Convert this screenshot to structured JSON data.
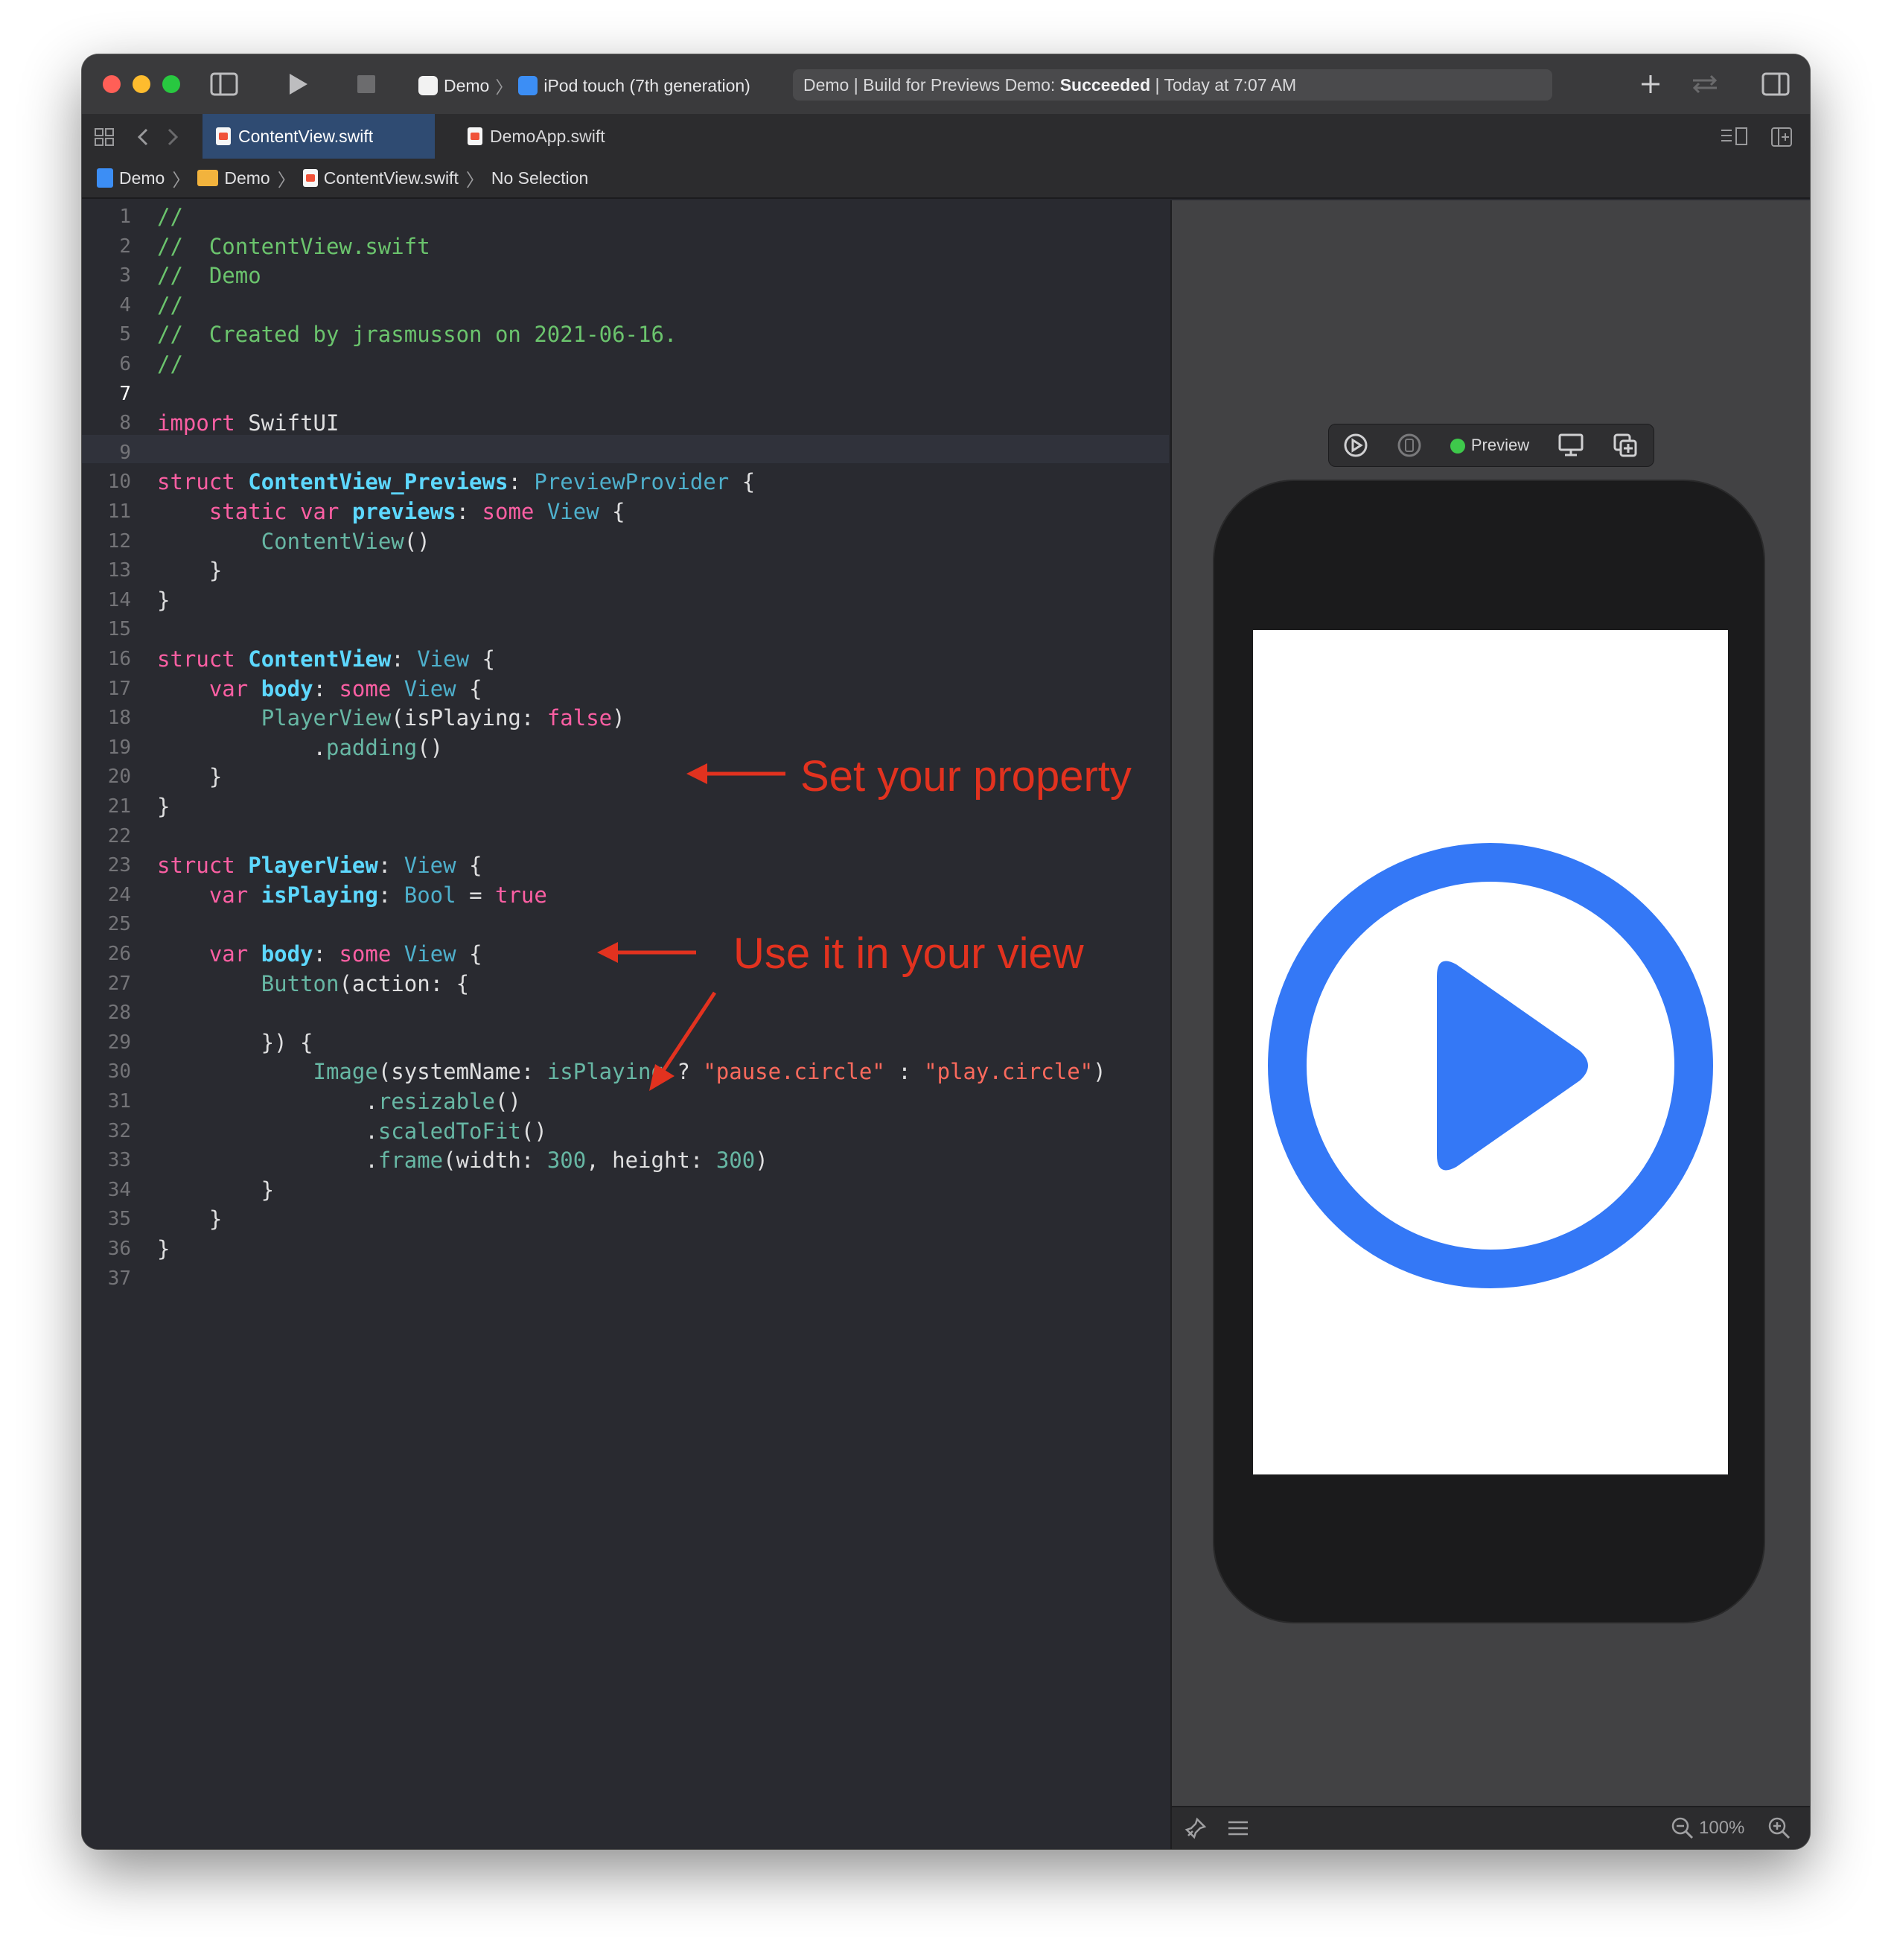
{
  "toolbar": {
    "scheme_app": "Demo",
    "scheme_device": "iPod touch (7th generation)",
    "activity_prefix": "Demo | Build for Previews Demo: ",
    "activity_status": "Succeeded",
    "activity_suffix": " | Today at 7:07 AM",
    "colors": {
      "close": "#ff5f57",
      "minimize": "#febc2e",
      "zoom": "#28c840"
    }
  },
  "tabs": [
    {
      "label": "ContentView.swift",
      "active": true
    },
    {
      "label": "DemoApp.swift",
      "active": false
    }
  ],
  "jumpbar": {
    "items": [
      "Demo",
      "Demo",
      "ContentView.swift",
      "No Selection"
    ]
  },
  "editor": {
    "current_line": 7,
    "lines": [
      [
        [
          "c-com",
          "//"
        ]
      ],
      [
        [
          "c-com",
          "//  ContentView.swift"
        ]
      ],
      [
        [
          "c-com",
          "//  Demo"
        ]
      ],
      [
        [
          "c-com",
          "//"
        ]
      ],
      [
        [
          "c-com",
          "//  Created by jrasmusson on 2021-06-16."
        ]
      ],
      [
        [
          "c-com",
          "//"
        ]
      ],
      [],
      [
        [
          "c-kw",
          "import"
        ],
        [
          "c-pl",
          " SwiftUI"
        ]
      ],
      [],
      [
        [
          "c-kw",
          "struct"
        ],
        [
          "c-pl",
          " "
        ],
        [
          "c-type",
          "ContentView_Previews"
        ],
        [
          "c-pl",
          ": "
        ],
        [
          "c-typ2",
          "PreviewProvider"
        ],
        [
          "c-pl",
          " {"
        ]
      ],
      [
        [
          "c-pl",
          "    "
        ],
        [
          "c-kw",
          "static var"
        ],
        [
          "c-pl",
          " "
        ],
        [
          "c-type",
          "previews"
        ],
        [
          "c-pl",
          ": "
        ],
        [
          "c-kw",
          "some"
        ],
        [
          "c-pl",
          " "
        ],
        [
          "c-typ2",
          "View"
        ],
        [
          "c-pl",
          " {"
        ]
      ],
      [
        [
          "c-pl",
          "        "
        ],
        [
          "c-call",
          "ContentView"
        ],
        [
          "c-pl",
          "()"
        ]
      ],
      [
        [
          "c-pl",
          "    }"
        ]
      ],
      [
        [
          "c-pl",
          "}"
        ]
      ],
      [],
      [
        [
          "c-kw",
          "struct"
        ],
        [
          "c-pl",
          " "
        ],
        [
          "c-type",
          "ContentView"
        ],
        [
          "c-pl",
          ": "
        ],
        [
          "c-typ2",
          "View"
        ],
        [
          "c-pl",
          " {"
        ]
      ],
      [
        [
          "c-pl",
          "    "
        ],
        [
          "c-kw",
          "var"
        ],
        [
          "c-pl",
          " "
        ],
        [
          "c-type",
          "body"
        ],
        [
          "c-pl",
          ": "
        ],
        [
          "c-kw",
          "some"
        ],
        [
          "c-pl",
          " "
        ],
        [
          "c-typ2",
          "View"
        ],
        [
          "c-pl",
          " {"
        ]
      ],
      [
        [
          "c-pl",
          "        "
        ],
        [
          "c-call",
          "PlayerView"
        ],
        [
          "c-pl",
          "(isPlaying: "
        ],
        [
          "c-kw",
          "false"
        ],
        [
          "c-pl",
          ")"
        ]
      ],
      [
        [
          "c-pl",
          "            ."
        ],
        [
          "c-call",
          "padding"
        ],
        [
          "c-pl",
          "()"
        ]
      ],
      [
        [
          "c-pl",
          "    }"
        ]
      ],
      [
        [
          "c-pl",
          "}"
        ]
      ],
      [],
      [
        [
          "c-kw",
          "struct"
        ],
        [
          "c-pl",
          " "
        ],
        [
          "c-type",
          "PlayerView"
        ],
        [
          "c-pl",
          ": "
        ],
        [
          "c-typ2",
          "View"
        ],
        [
          "c-pl",
          " {"
        ]
      ],
      [
        [
          "c-pl",
          "    "
        ],
        [
          "c-kw",
          "var"
        ],
        [
          "c-pl",
          " "
        ],
        [
          "c-type",
          "isPlaying"
        ],
        [
          "c-pl",
          ": "
        ],
        [
          "c-typ2",
          "Bool"
        ],
        [
          "c-pl",
          " = "
        ],
        [
          "c-kw",
          "true"
        ]
      ],
      [],
      [
        [
          "c-pl",
          "    "
        ],
        [
          "c-kw",
          "var"
        ],
        [
          "c-pl",
          " "
        ],
        [
          "c-type",
          "body"
        ],
        [
          "c-pl",
          ": "
        ],
        [
          "c-kw",
          "some"
        ],
        [
          "c-pl",
          " "
        ],
        [
          "c-typ2",
          "View"
        ],
        [
          "c-pl",
          " {"
        ]
      ],
      [
        [
          "c-pl",
          "        "
        ],
        [
          "c-call",
          "Button"
        ],
        [
          "c-pl",
          "(action: {"
        ]
      ],
      [],
      [
        [
          "c-pl",
          "        }) {"
        ]
      ],
      [
        [
          "c-pl",
          "            "
        ],
        [
          "c-call",
          "Image"
        ],
        [
          "c-pl",
          "(systemName: "
        ],
        [
          "c-call",
          "isPlaying"
        ],
        [
          "c-pl",
          " ? "
        ],
        [
          "c-str",
          "\"pause.circle\""
        ],
        [
          "c-pl",
          " : "
        ],
        [
          "c-str",
          "\"play.circle\""
        ],
        [
          "c-pl",
          ")"
        ]
      ],
      [
        [
          "c-pl",
          "                ."
        ],
        [
          "c-call",
          "resizable"
        ],
        [
          "c-pl",
          "()"
        ]
      ],
      [
        [
          "c-pl",
          "                ."
        ],
        [
          "c-call",
          "scaledToFit"
        ],
        [
          "c-pl",
          "()"
        ]
      ],
      [
        [
          "c-pl",
          "                ."
        ],
        [
          "c-call",
          "frame"
        ],
        [
          "c-pl",
          "(width: "
        ],
        [
          "c-call",
          "300"
        ],
        [
          "c-pl",
          ", height: "
        ],
        [
          "c-call",
          "300"
        ],
        [
          "c-pl",
          ")"
        ]
      ],
      [
        [
          "c-pl",
          "        }"
        ]
      ],
      [
        [
          "c-pl",
          "    }"
        ]
      ],
      [
        [
          "c-pl",
          "}"
        ]
      ],
      []
    ]
  },
  "annotations": {
    "set_property": "Set your property",
    "use_in_view": "Use it in your view",
    "color": "#e2321f"
  },
  "preview": {
    "label": "Preview",
    "zoom": "100%",
    "accent": "#3478f6",
    "icon": "play-circle-icon"
  }
}
